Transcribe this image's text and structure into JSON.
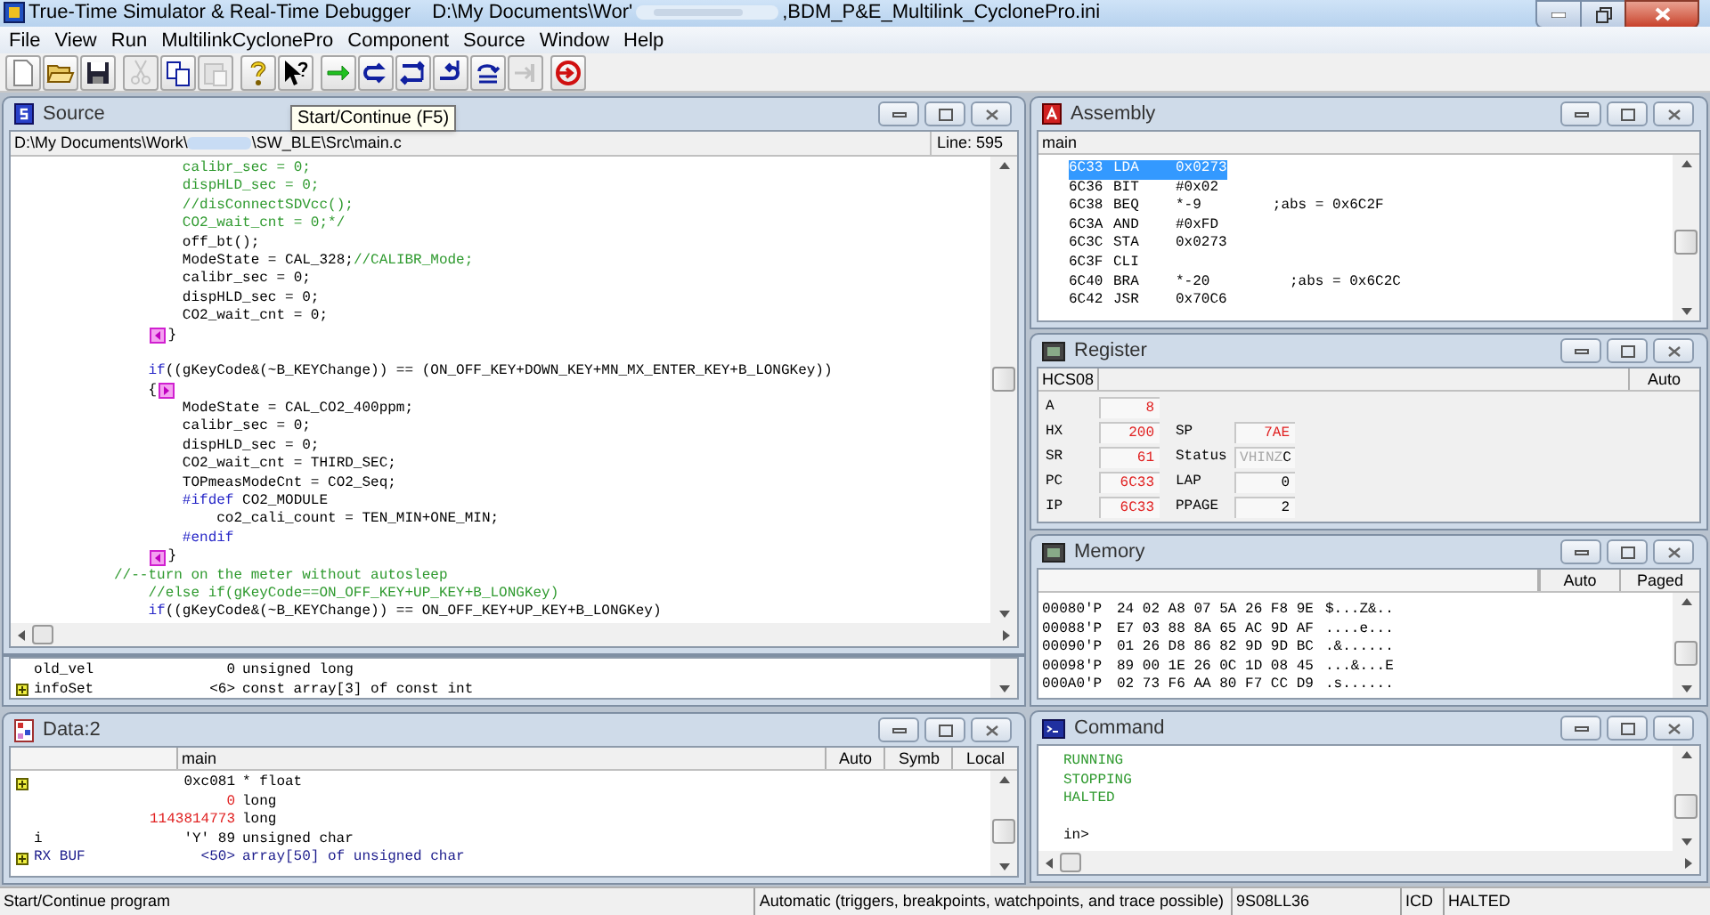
{
  "app": {
    "title": "True-Time Simulator & Real-Time Debugger",
    "path_start": "D:\\My Documents\\Wor'",
    "path_end": ",BDM_P&E_Multilink_CyclonePro.ini"
  },
  "menu": [
    "File",
    "View",
    "Run",
    "MultilinkCyclonePro",
    "Component",
    "Source",
    "Window",
    "Help"
  ],
  "toolbar": [
    [
      {
        "kind": "new",
        "disabled": false
      },
      {
        "kind": "open",
        "disabled": false
      },
      {
        "kind": "save",
        "disabled": false
      }
    ],
    [
      {
        "kind": "cut",
        "disabled": true
      },
      {
        "kind": "copy",
        "disabled": false
      },
      {
        "kind": "paste",
        "disabled": true
      }
    ],
    [
      {
        "kind": "help",
        "disabled": false
      },
      {
        "kind": "context_help",
        "disabled": false
      }
    ],
    [
      {
        "kind": "start",
        "disabled": false
      },
      {
        "kind": "step",
        "disabled": false
      },
      {
        "kind": "step_over",
        "disabled": false
      },
      {
        "kind": "step_out",
        "disabled": false
      },
      {
        "kind": "asm_step",
        "disabled": false
      },
      {
        "kind": "halt",
        "disabled": true
      }
    ],
    [
      {
        "kind": "reset",
        "disabled": false
      }
    ]
  ],
  "tooltip": "Start/Continue (F5)",
  "source": {
    "title": "Source",
    "path_start": "D:\\My Documents\\Work\\",
    "path_end": "\\SW_BLE\\Src\\main.c",
    "line": "Line: 595",
    "lines": [
      [
        {
          "kind": "comment",
          "text": "                  calibr_sec = 0;"
        }
      ],
      [
        {
          "kind": "comment",
          "text": "                  dispHLD_sec = 0;"
        }
      ],
      [
        {
          "kind": "comment",
          "text": "                  //disConnectSDVcc();"
        }
      ],
      [
        {
          "kind": "comment",
          "text": "                  CO2_wait_cnt = 0;*/"
        }
      ],
      [
        {
          "kind": "code",
          "text": "                  off_bt();"
        }
      ],
      [
        {
          "kind": "code",
          "text": "                  ModeState = CAL_328;"
        },
        {
          "kind": "comment",
          "text": "//CALIBR_Mode;"
        }
      ],
      [
        {
          "kind": "code",
          "text": "                  calibr_sec = 0;"
        }
      ],
      [
        {
          "kind": "code",
          "text": "                  dispHLD_sec = 0;"
        }
      ],
      [
        {
          "kind": "code",
          "text": "                  CO2_wait_cnt = 0;"
        }
      ],
      [
        {
          "kind": "code",
          "text": "              }",
          "marked": true
        }
      ],
      [
        {
          "kind": "blank"
        }
      ],
      [
        {
          "kind": "keyword",
          "text": "              if"
        },
        {
          "kind": "code",
          "text": "((gKeyCode&(~B_KEYChange)) == (ON_OFF_KEY+DOWN_KEY+MN_MX_ENTER_KEY+B_LONGKey))"
        }
      ],
      [
        {
          "kind": "code",
          "text": "              {"
        },
        {
          "kind": "mark_right"
        }
      ],
      [
        {
          "kind": "code",
          "text": "                  ModeState = CAL_CO2_400ppm;"
        }
      ],
      [
        {
          "kind": "code",
          "text": "                  calibr_sec = 0;"
        }
      ],
      [
        {
          "kind": "code",
          "text": "                  dispHLD_sec = 0;"
        }
      ],
      [
        {
          "kind": "code",
          "text": "                  CO2_wait_cnt = THIRD_SEC;"
        }
      ],
      [
        {
          "kind": "code",
          "text": "                  TOPmeasModeCnt = CO2_Seq;"
        }
      ],
      [
        {
          "kind": "keyword",
          "text": "                  #ifdef"
        },
        {
          "kind": "code",
          "text": " CO2_MODULE"
        }
      ],
      [
        {
          "kind": "code",
          "text": "                      co2_cali_count = TEN_MIN+ONE_MIN;"
        }
      ],
      [
        {
          "kind": "keyword",
          "text": "                  #endif"
        }
      ],
      [
        {
          "kind": "code",
          "text": "              }",
          "marked": true
        }
      ],
      [
        {
          "kind": "comment",
          "text": "          //--turn on the meter without autosleep"
        }
      ],
      [
        {
          "kind": "comment",
          "text": "              //else if(gKeyCode==ON_OFF_KEY+UP_KEY+B_LONGKey)"
        }
      ],
      [
        {
          "kind": "keyword",
          "text": "              if"
        },
        {
          "kind": "code",
          "text": "((gKeyCode&(~B_KEYChange)) == ON_OFF_KEY+UP_KEY+B_LONGKey)"
        }
      ]
    ]
  },
  "variables": {
    "rows": [
      {
        "expandable": false,
        "name": "old_vel",
        "value": "0",
        "type": "unsigned long",
        "changed": false,
        "color": "#000000"
      },
      {
        "expandable": true,
        "name": "infoSet",
        "value": "<6>",
        "type": "const array[3] of const int",
        "changed": false,
        "color": "#000000"
      }
    ]
  },
  "data": {
    "title": "Data:2",
    "scope": "main",
    "buttons": [
      "Auto",
      "Symb",
      "Local"
    ],
    "rows": [
      {
        "expandable": true,
        "name": "",
        "value": "0xc081",
        "type": "* float",
        "changed": false,
        "color": "#000000"
      },
      {
        "expandable": false,
        "name": "",
        "value": "0",
        "type": "long",
        "changed": true,
        "color": "#000000"
      },
      {
        "expandable": false,
        "name": "",
        "value": "1143814773",
        "type": "long",
        "changed": true,
        "color": "#000000"
      },
      {
        "expandable": false,
        "name": "i",
        "value": "'Y' 89",
        "type": "unsigned char",
        "changed": false,
        "color": "#000000"
      },
      {
        "expandable": true,
        "name": "RX BUF",
        "value": "<50>",
        "type": "array[50] of unsigned char",
        "changed": false,
        "color": "#1c1c8c"
      }
    ]
  },
  "assembly": {
    "title": "Assembly",
    "scope": "main",
    "rows": [
      {
        "address": "6C33",
        "mnemonic": "LDA",
        "operand": "0x0273",
        "comment": "",
        "selected": true
      },
      {
        "address": "6C36",
        "mnemonic": "BIT",
        "operand": "#0x02",
        "comment": "",
        "selected": false
      },
      {
        "address": "6C38",
        "mnemonic": "BEQ",
        "operand": "*-9",
        "comment": ";abs = 0x6C2F",
        "selected": false
      },
      {
        "address": "6C3A",
        "mnemonic": "AND",
        "operand": "#0xFD",
        "comment": "",
        "selected": false
      },
      {
        "address": "6C3C",
        "mnemonic": "STA",
        "operand": "0x0273",
        "comment": "",
        "selected": false
      },
      {
        "address": "6C3F",
        "mnemonic": "CLI",
        "operand": "",
        "comment": "",
        "selected": false
      },
      {
        "address": "6C40",
        "mnemonic": "BRA",
        "operand": "*-20",
        "comment": " ;abs = 0x6C2C",
        "selected": false
      },
      {
        "address": "6C42",
        "mnemonic": "JSR",
        "operand": "0x70C6",
        "comment": "",
        "selected": false
      }
    ]
  },
  "register": {
    "title": "Register",
    "cpu": "HCS08",
    "mode": "Auto",
    "rows": [
      [
        {
          "label": "A",
          "kind": "value",
          "value": "8",
          "changed": true
        }
      ],
      [
        {
          "label": "HX",
          "kind": "value",
          "value": "200",
          "changed": true
        },
        {
          "label": "SP",
          "kind": "value",
          "value": "7AE",
          "changed": true
        }
      ],
      [
        {
          "label": "SR",
          "kind": "value",
          "value": "61",
          "changed": true
        },
        {
          "label": "Status",
          "kind": "flags",
          "flags": [
            {
              "text": "V",
              "set": false
            },
            {
              "text": "H",
              "set": false
            },
            {
              "text": "I",
              "set": false
            },
            {
              "text": "N",
              "set": false
            },
            {
              "text": "Z",
              "set": false
            },
            {
              "text": "C",
              "set": true
            }
          ]
        }
      ],
      [
        {
          "label": "PC",
          "kind": "value",
          "value": "6C33",
          "changed": true
        },
        {
          "label": "LAP",
          "kind": "value",
          "value": "0",
          "changed": false
        }
      ],
      [
        {
          "label": "IP",
          "kind": "value",
          "value": "6C33",
          "changed": true
        },
        {
          "label": "PPAGE",
          "kind": "value",
          "value": "2",
          "changed": false
        }
      ]
    ]
  },
  "memory": {
    "title": "Memory",
    "buttons": [
      "Auto",
      "Paged"
    ],
    "rows": [
      {
        "address": "00080'P",
        "bytes": "24 02 A8 07 5A 26 F8 9E",
        "ascii": "$...Z&.."
      },
      {
        "address": "00088'P",
        "bytes": "E7 03 88 8A 65 AC 9D AF",
        "ascii": "....e..."
      },
      {
        "address": "00090'P",
        "bytes": "01 26 D8 86 82 9D 9D BC",
        "ascii": ".&......"
      },
      {
        "address": "00098'P",
        "bytes": "89 00 1E 26 0C 1D 08 45",
        "ascii": "...&...E"
      },
      {
        "address": "000A0'P",
        "bytes": "02 73 F6 AA 80 F7 CC D9",
        "ascii": ".s......"
      }
    ]
  },
  "command": {
    "title": "Command",
    "lines": [
      {
        "kind": "output",
        "text": "RUNNING"
      },
      {
        "kind": "output",
        "text": "STOPPING"
      },
      {
        "kind": "output",
        "text": "HALTED"
      },
      {
        "kind": "blank"
      },
      {
        "kind": "prompt",
        "text": "in>"
      }
    ]
  },
  "status_bar": [
    "Start/Continue program",
    "Automatic (triggers, breakpoints, watchpoints, and trace possible)",
    "9S08LL36",
    "ICD",
    "HALTED"
  ]
}
